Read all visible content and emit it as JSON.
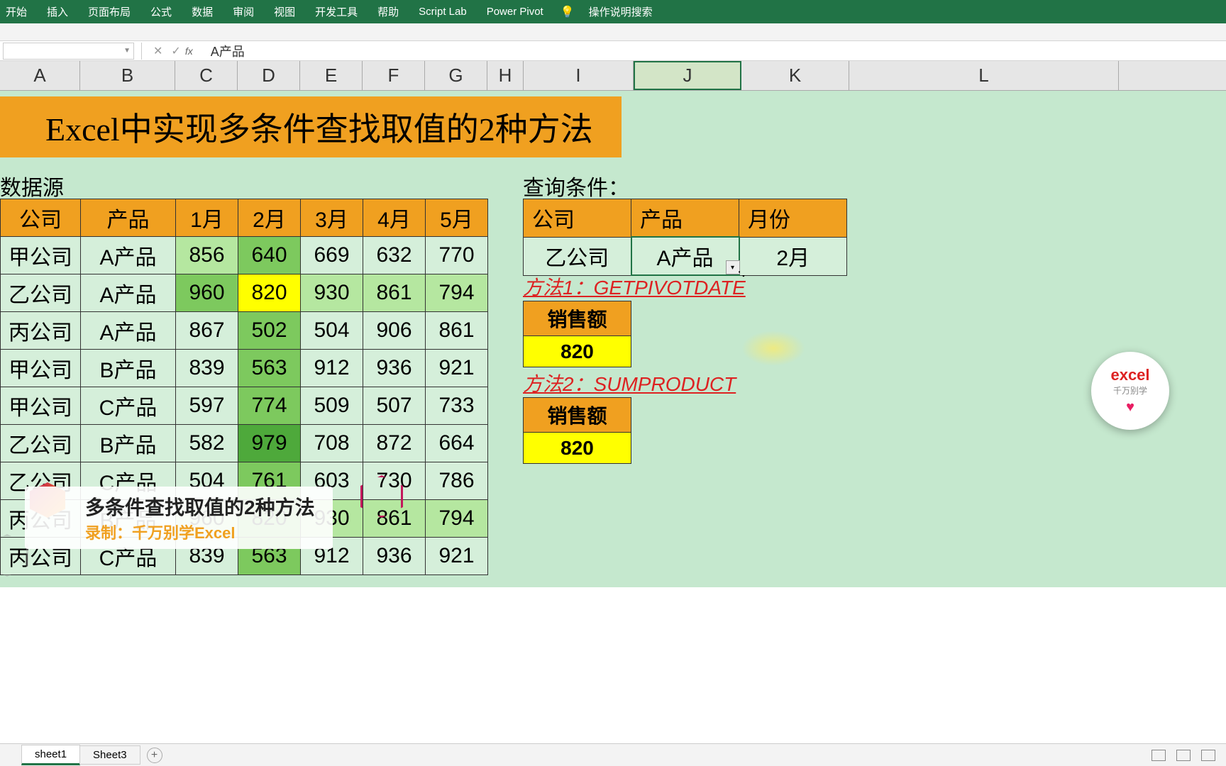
{
  "ribbon": {
    "tabs": [
      "开始",
      "插入",
      "页面布局",
      "公式",
      "数据",
      "审阅",
      "视图",
      "开发工具",
      "帮助",
      "Script Lab",
      "Power Pivot"
    ],
    "tellme": "操作说明搜索"
  },
  "formula_bar": {
    "name_box": "",
    "fx_label": "fx",
    "formula": "A产品"
  },
  "columns": [
    "A",
    "B",
    "C",
    "D",
    "E",
    "F",
    "G",
    "H",
    "I",
    "J",
    "K",
    "L"
  ],
  "selected_column": "J",
  "title": "Excel中实现多条件查找取值的2种方法",
  "labels": {
    "datasource": "数据源",
    "query": "查询条件："
  },
  "data_table": {
    "headers": [
      "公司",
      "产品",
      "1月",
      "2月",
      "3月",
      "4月",
      "5月"
    ],
    "rows": [
      [
        "甲公司",
        "A产品",
        "856",
        "640",
        "669",
        "632",
        "770"
      ],
      [
        "乙公司",
        "A产品",
        "960",
        "820",
        "930",
        "861",
        "794"
      ],
      [
        "丙公司",
        "A产品",
        "867",
        "502",
        "504",
        "906",
        "861"
      ],
      [
        "甲公司",
        "B产品",
        "839",
        "563",
        "912",
        "936",
        "921"
      ],
      [
        "甲公司",
        "C产品",
        "597",
        "774",
        "509",
        "507",
        "733"
      ],
      [
        "乙公司",
        "B产品",
        "582",
        "979",
        "708",
        "872",
        "664"
      ],
      [
        "乙公司",
        "C产品",
        "504",
        "761",
        "603",
        "730",
        "786"
      ],
      [
        "丙公司",
        "B产品",
        "960",
        "820",
        "930",
        "861",
        "794"
      ],
      [
        "丙公司",
        "C产品",
        "839",
        "563",
        "912",
        "936",
        "921"
      ]
    ]
  },
  "query_table": {
    "headers": [
      "公司",
      "产品",
      "月份"
    ],
    "values": [
      "乙公司",
      "A产品",
      "2月"
    ]
  },
  "methods": {
    "m1_label": "方法1：GETPIVOTDATE",
    "m2_label": "方法2：SUMPRODUCT",
    "result_header": "销售额",
    "result_value": "820"
  },
  "watermark": {
    "title": "excel",
    "sub": "千万别学"
  },
  "caption": {
    "title": "多条件查找取值的2种方法",
    "sub": "录制：千万别学Excel"
  },
  "sheets": {
    "tab1": "sheet1",
    "tab2": "Sheet3"
  }
}
